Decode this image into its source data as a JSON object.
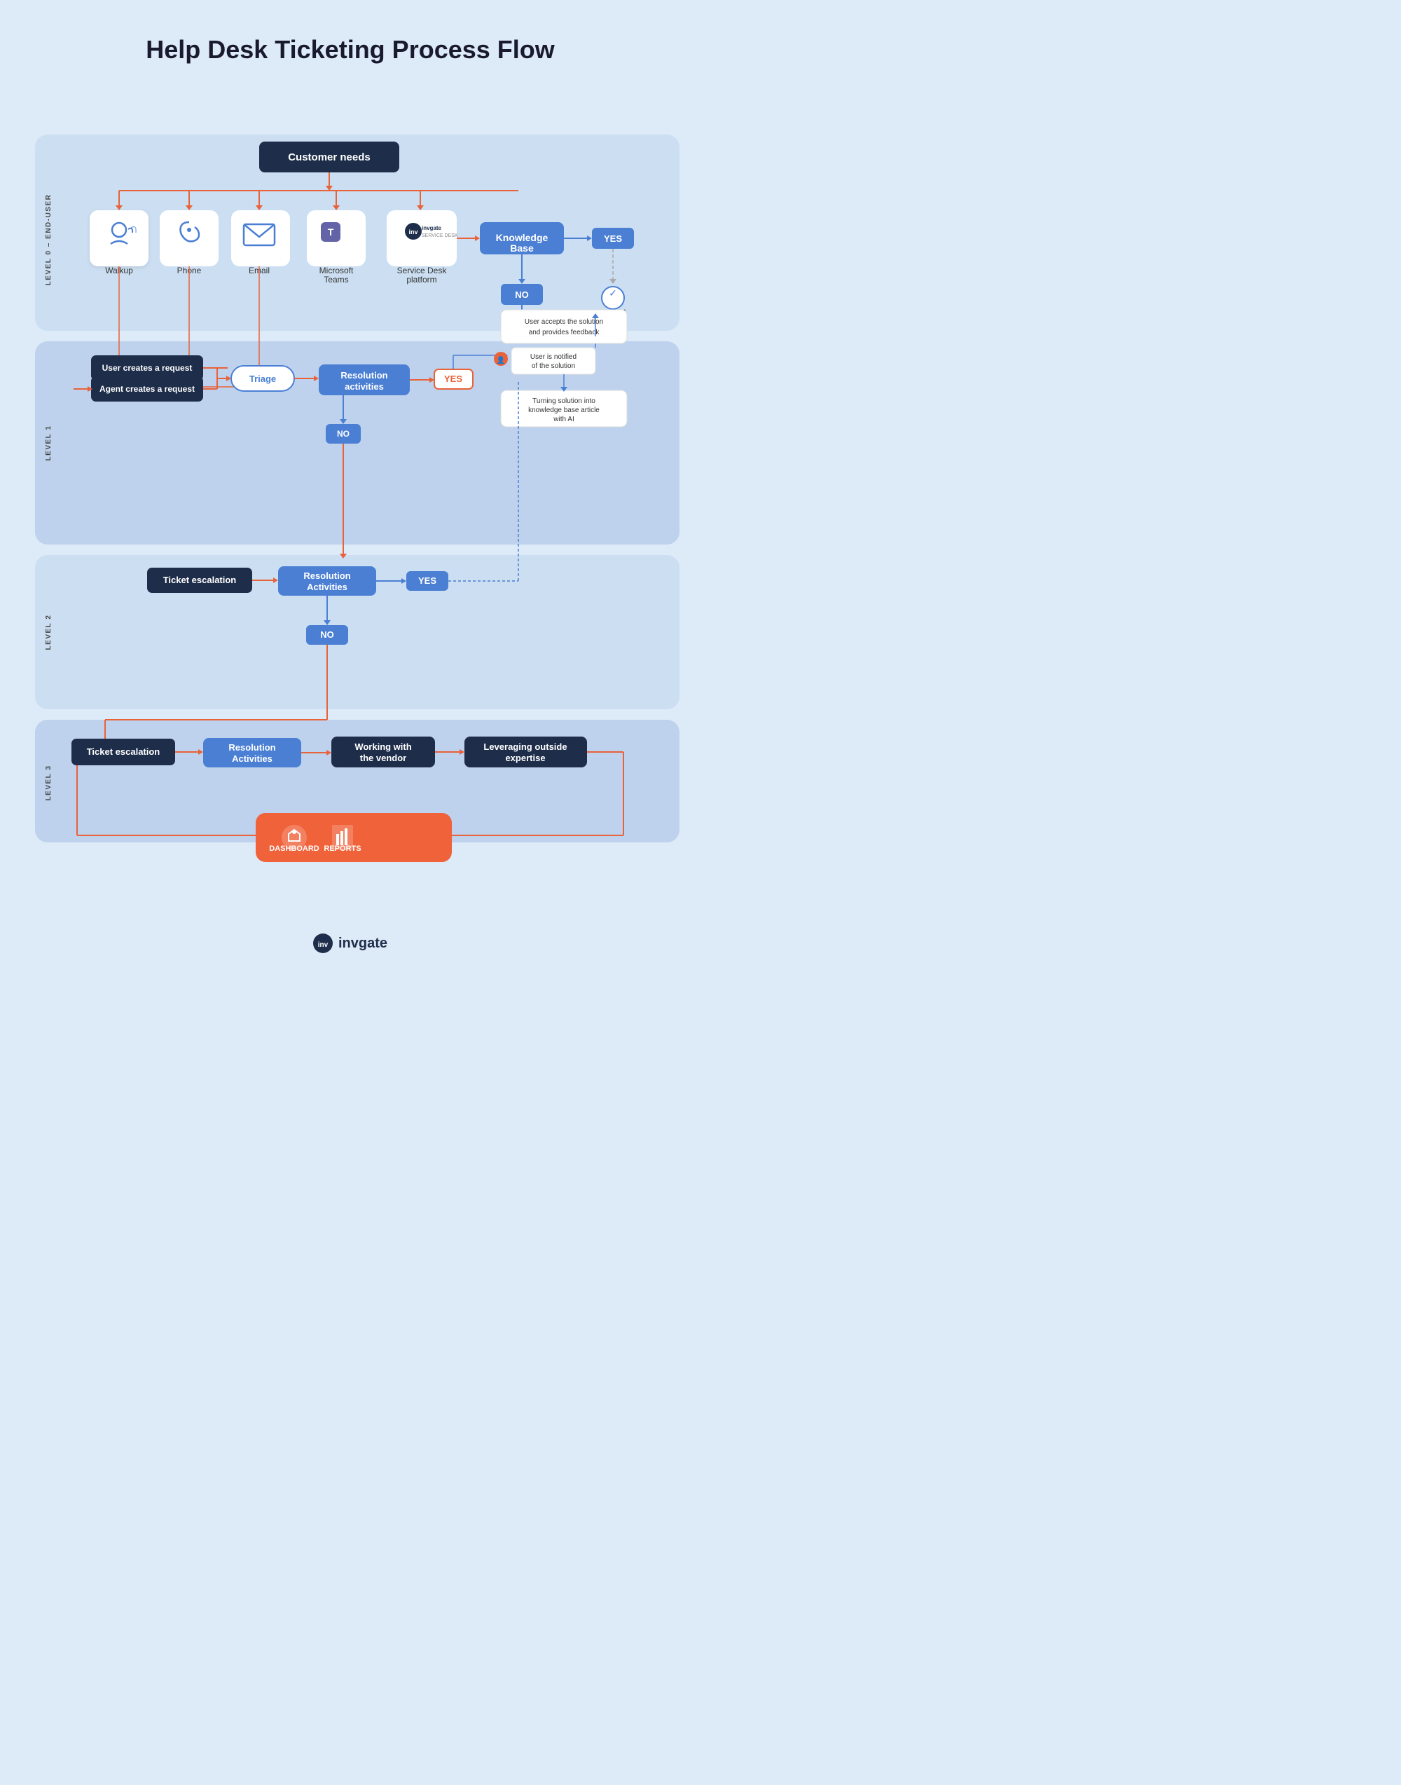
{
  "title": "Help Desk Ticketing Process Flow",
  "levels": {
    "level0": "LEVEL 0 – END-USER",
    "level1": "LEVEL 1",
    "level2": "LEVEL 2",
    "level3": "LEVEL 3"
  },
  "nodes": {
    "customer_needs": "Customer needs",
    "walkup": "Walkup",
    "phone": "Phone",
    "email": "Email",
    "microsoft_teams": "Microsoft Teams",
    "service_desk": "Service Desk platform",
    "knowledge_base": "Knowledge Base",
    "yes": "YES",
    "no": "NO",
    "solved": "Solved",
    "user_creates": "User creates a request",
    "agent_creates": "Agent creates a request",
    "triage": "Triage",
    "resolution_activities_l1": "Resolution activities",
    "user_notified": "User is notified of the solution",
    "user_accepts": "User accepts the solution and provides feedback",
    "turning_solution": "Turning solution into knowledge base article with AI",
    "ticket_escalation_l2": "Ticket escalation",
    "resolution_activities_l2": "Resolution Activities",
    "ticket_escalation_l3": "Ticket escalation",
    "resolution_activities_l3": "Resolution Activities",
    "working_vendor": "Working with the vendor",
    "leveraging_outside": "Leveraging outside expertise",
    "dashboard": "DASHBOARD",
    "reports": "REPORTS"
  },
  "colors": {
    "bg": "#ddeaf7",
    "level0_bg": "#c8ddf5",
    "level1_bg": "#b8d0ee",
    "level2_bg": "#c8ddf5",
    "level3_bg": "#b8d0ee",
    "dark_box": "#1e2d4a",
    "blue_box": "#4a7fd4",
    "orange_box": "#f0623a",
    "arrow": "#e8623a",
    "arrow_dark": "#4a7fd4"
  }
}
